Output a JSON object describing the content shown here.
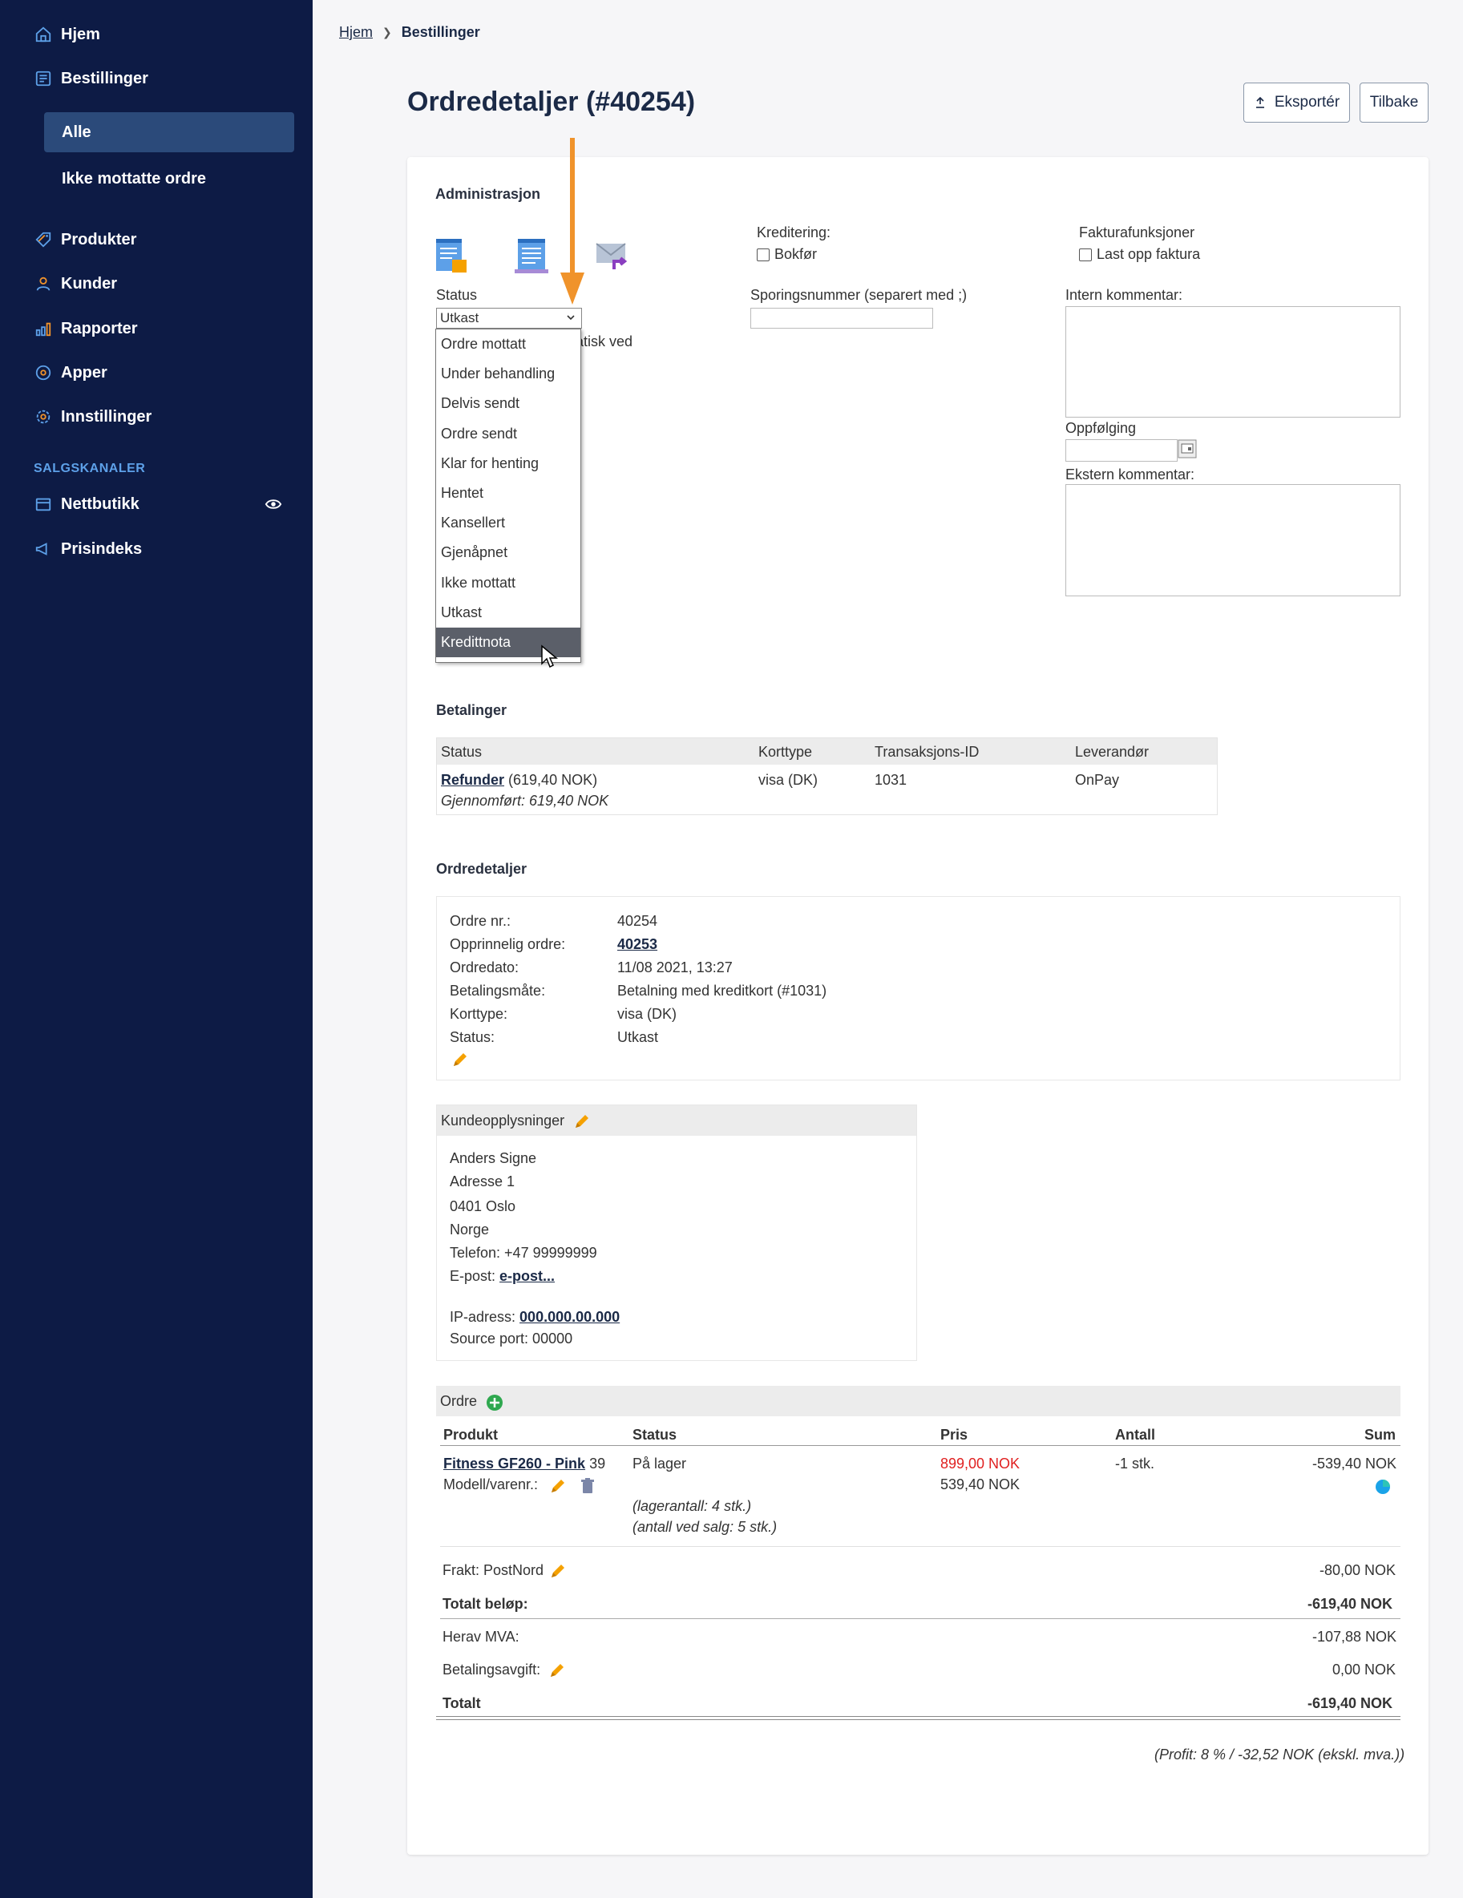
{
  "sidebar": {
    "items": [
      {
        "label": "Hjem",
        "icon": "home-icon"
      },
      {
        "label": "Bestillinger",
        "icon": "orders-icon"
      },
      {
        "label": "Produkter",
        "icon": "tag-icon"
      },
      {
        "label": "Kunder",
        "icon": "user-icon"
      },
      {
        "label": "Rapporter",
        "icon": "bar-chart-icon"
      },
      {
        "label": "Apper",
        "icon": "apps-icon"
      },
      {
        "label": "Innstillinger",
        "icon": "gear-icon"
      }
    ],
    "sub_items": [
      {
        "label": "Alle",
        "active": true
      },
      {
        "label": "Ikke mottatte ordre",
        "active": false
      }
    ],
    "section_label": "SALGSKANALER",
    "channels": [
      {
        "label": "Nettbutikk",
        "icon": "store-icon"
      },
      {
        "label": "Prisindeks",
        "icon": "megaphone-icon"
      }
    ],
    "accent": "#5da0e8",
    "background": "#0d1b45"
  },
  "breadcrumb": {
    "home": "Hjem",
    "current": "Bestillinger"
  },
  "header": {
    "title": "Ordredetaljer (#40254)",
    "export_label": "Eksportér",
    "back_label": "Tilbake"
  },
  "admin": {
    "title": "Administrasjon",
    "status_label": "Status",
    "status_value": "Utkast",
    "status_options": [
      "Ordre mottatt",
      "Under behandling",
      "Delvis sendt",
      "Ordre sendt",
      "Klar for henting",
      "Hentet",
      "Kansellert",
      "Gjenåpnet",
      "Ikke mottatt",
      "Utkast",
      "Kredittnota"
    ],
    "hidden_text": "atisk ved",
    "credit_label": "Kreditering:",
    "credit_checkbox": "Bokfør",
    "tracking_label": "Sporingsnummer (separert med ;)",
    "invoice_label": "Fakturafunksjoner",
    "invoice_checkbox": "Last opp faktura",
    "internal_comment_label": "Intern kommentar:",
    "followup_label": "Oppfølging",
    "external_comment_label": "Ekstern kommentar:"
  },
  "payments": {
    "title": "Betalinger",
    "columns": [
      "Status",
      "Korttype",
      "Transaksjons-ID",
      "Leverandør"
    ],
    "row": {
      "status_link": "Refunder",
      "status_amount": "(619,40 NOK)",
      "status_note": "Gjennomført: 619,40 NOK",
      "card_type": "visa (DK)",
      "transaction_id": "1031",
      "provider": "OnPay"
    }
  },
  "order_details": {
    "title": "Ordredetaljer",
    "rows": [
      {
        "label": "Ordre nr.:",
        "value": "40254"
      },
      {
        "label": "Opprinnelig ordre:",
        "value": "40253"
      },
      {
        "label": "Ordredato:",
        "value": "11/08 2021, 13:27"
      },
      {
        "label": "Betalingsmåte:",
        "value": "Betalning med kreditkort (#1031)"
      },
      {
        "label": "Korttype:",
        "value": "visa (DK)"
      },
      {
        "label": "Status:",
        "value": "Utkast"
      }
    ]
  },
  "customer": {
    "title": "Kundeopplysninger",
    "name": "Anders Signe",
    "address": "Adresse 1",
    "postal": "0401 Oslo",
    "country": "Norge",
    "phone": "Telefon: +47 99999999",
    "email_label": "E-post:",
    "email_link": "e-post...",
    "ip_label": "IP-adress:",
    "ip_value": "000.000.00.000",
    "source_port": "Source port: 00000"
  },
  "order": {
    "title": "Ordre",
    "columns": [
      "Produkt",
      "Status",
      "Pris",
      "Antall",
      "Sum"
    ],
    "line": {
      "product_link": "Fitness GF260 - Pink",
      "product_suffix": "39",
      "model_label": "Modell/varenr.:",
      "status": "På lager",
      "stock_note": "(lagerantall: 4 stk.)",
      "sale_note": "(antall ved salg: 5 stk.)",
      "price_original": "899,00 NOK",
      "price": "539,40 NOK",
      "qty": "-1 stk.",
      "sum": "-539,40 NOK"
    },
    "shipping_label": "Frakt: PostNord",
    "shipping_value": "-80,00 NOK",
    "total_amount_label": "Totalt beløp:",
    "total_amount_value": "-619,40 NOK",
    "vat_label": "Herav MVA:",
    "vat_value": "-107,88 NOK",
    "fee_label": "Betalingsavgift:",
    "fee_value": "0,00 NOK",
    "total_label": "Totalt",
    "total_value": "-619,40 NOK",
    "profit_note": "(Profit: 8 % / -32,52 NOK (ekskl. mva.))"
  },
  "colors": {
    "annotation_arrow": "#f0932b",
    "pencil": "#f5a100",
    "add": "#2fa84f",
    "price_red": "#e02020"
  }
}
